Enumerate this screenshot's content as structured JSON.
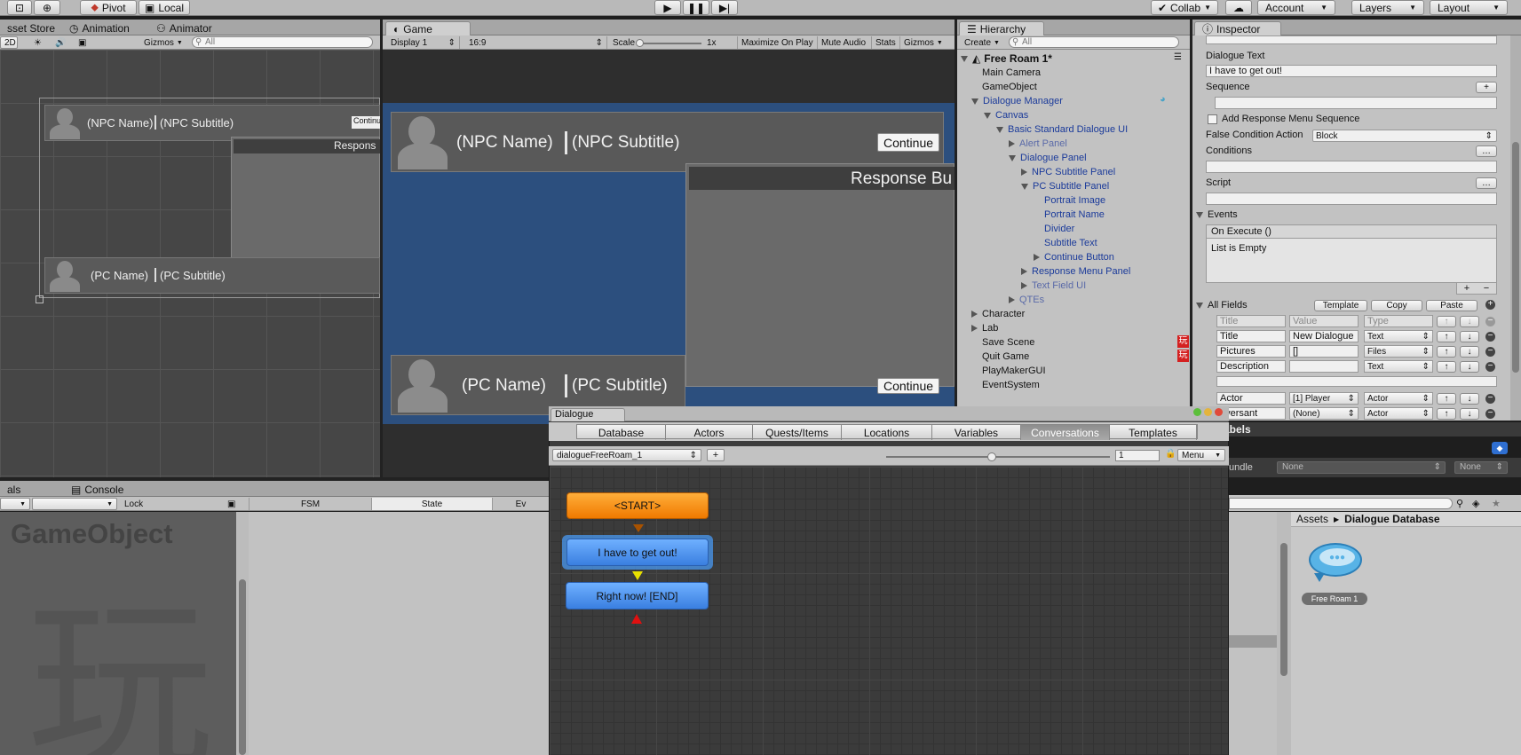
{
  "toolbar": {
    "pivot": "Pivot",
    "local": "Local",
    "collab": "Collab",
    "account": "Account",
    "layers": "Layers",
    "layout": "Layout"
  },
  "scene_panel": {
    "tabs": [
      "sset Store",
      "Animation",
      "Animator"
    ],
    "strip": {
      "mode2d": "2D",
      "gizmos": "Gizmos",
      "search_placeholder": "All"
    },
    "npc_name": "(NPC Name)",
    "npc_subtitle": "(NPC Subtitle)",
    "continue": "Continu",
    "response": "Respons",
    "pc_name": "(PC Name)",
    "pc_subtitle": "(PC Subtitle)"
  },
  "game_panel": {
    "tab": "Game",
    "display": "Display 1",
    "aspect": "16:9",
    "scale_label": "Scale",
    "scale_value": "1x",
    "maximize": "Maximize On Play",
    "mute": "Mute Audio",
    "stats": "Stats",
    "gizmos": "Gizmos",
    "npc_name": "(NPC Name)",
    "npc_subtitle": "(NPC Subtitle)",
    "continue": "Continue",
    "response": "Response Bu",
    "pc_name": "(PC Name)",
    "pc_subtitle": "(PC Subtitle)",
    "pc_continue": "Continue"
  },
  "hierarchy": {
    "tab": "Hierarchy",
    "create": "Create",
    "search_placeholder": "All",
    "scene": "Free Roam 1*",
    "items": [
      {
        "label": "Main Camera",
        "indent": 1,
        "arrow": "",
        "color": "#111111"
      },
      {
        "label": "GameObject",
        "indent": 1,
        "arrow": "",
        "color": "#111111"
      },
      {
        "label": "Dialogue Manager",
        "indent": 1,
        "arrow": "down",
        "color": "#1a3a9a"
      },
      {
        "label": "Canvas",
        "indent": 2,
        "arrow": "down",
        "color": "#1a3a9a"
      },
      {
        "label": "Basic Standard Dialogue UI",
        "indent": 3,
        "arrow": "down",
        "color": "#1a3a9a"
      },
      {
        "label": "Alert Panel",
        "indent": 4,
        "arrow": "right",
        "color": "#5a6aa8"
      },
      {
        "label": "Dialogue Panel",
        "indent": 4,
        "arrow": "down",
        "color": "#1a3a9a"
      },
      {
        "label": "NPC Subtitle Panel",
        "indent": 5,
        "arrow": "right",
        "color": "#1a3a9a"
      },
      {
        "label": "PC Subtitle Panel",
        "indent": 5,
        "arrow": "down",
        "color": "#1a3a9a"
      },
      {
        "label": "Portrait Image",
        "indent": 6,
        "arrow": "",
        "color": "#1a3a9a"
      },
      {
        "label": "Portrait Name",
        "indent": 6,
        "arrow": "",
        "color": "#1a3a9a"
      },
      {
        "label": "Divider",
        "indent": 6,
        "arrow": "",
        "color": "#1a3a9a"
      },
      {
        "label": "Subtitle Text",
        "indent": 6,
        "arrow": "",
        "color": "#1a3a9a"
      },
      {
        "label": "Continue Button",
        "indent": 6,
        "arrow": "right",
        "color": "#1a3a9a"
      },
      {
        "label": "Response Menu Panel",
        "indent": 5,
        "arrow": "right",
        "color": "#1a3a9a"
      },
      {
        "label": "Text Field UI",
        "indent": 5,
        "arrow": "right",
        "color": "#5a6aa8"
      },
      {
        "label": "QTEs",
        "indent": 4,
        "arrow": "right",
        "color": "#5a6aa8"
      },
      {
        "label": "Character",
        "indent": 1,
        "arrow": "right",
        "color": "#111111"
      },
      {
        "label": "Lab",
        "indent": 1,
        "arrow": "right",
        "color": "#111111"
      },
      {
        "label": "Save Scene",
        "indent": 1,
        "arrow": "",
        "color": "#111111"
      },
      {
        "label": "Quit Game",
        "indent": 1,
        "arrow": "",
        "color": "#111111"
      },
      {
        "label": "PlayMakerGUI",
        "indent": 1,
        "arrow": "",
        "color": "#111111"
      },
      {
        "label": "EventSystem",
        "indent": 1,
        "arrow": "",
        "color": "#111111"
      }
    ],
    "badge_glyph": "玩"
  },
  "inspector": {
    "tab": "Inspector",
    "dialogue_text_label": "Dialogue Text",
    "dialogue_text_value": "I have to get out!",
    "sequence_label": "Sequence",
    "add_response_label": "Add Response Menu Sequence",
    "false_condition_label": "False Condition Action",
    "false_condition_value": "Block",
    "conditions_label": "Conditions",
    "script_label": "Script",
    "events_label": "Events",
    "on_execute": "On Execute ()",
    "list_empty": "List is Empty",
    "all_fields_label": "All Fields",
    "template_btn": "Template",
    "copy_btn": "Copy",
    "paste_btn": "Paste",
    "header": {
      "title": "Title",
      "value": "Value",
      "type": "Type"
    },
    "rows": [
      {
        "name": "Title",
        "value": "New Dialogue",
        "type": "Text"
      },
      {
        "name": "Pictures",
        "value": "[]",
        "type": "Files"
      },
      {
        "name": "Description",
        "value": "",
        "type": "Text"
      },
      {
        "name": "Actor",
        "value": "[1] Player",
        "type": "Actor"
      },
      {
        "name": "nversant",
        "value": "(None)",
        "type": "Actor"
      }
    ],
    "labels_caption": "abels",
    "bundle_label": "undle",
    "bundle_value": "None",
    "bundle_variant": "None"
  },
  "dialogue_window": {
    "title": "Dialogue",
    "tabs": [
      "Database",
      "Actors",
      "Quests/Items",
      "Locations",
      "Variables",
      "Conversations",
      "Templates"
    ],
    "active_tab": "Conversations",
    "conversation": "dialogueFreeRoam_1",
    "add": "+",
    "zoom_value": "1",
    "menu": "Menu",
    "nodes": {
      "start": "<START>",
      "line1": "I have to get out!",
      "line2": "Right now! [END]"
    }
  },
  "bottom_left": {
    "tab1": "als",
    "tab2": "Console",
    "lock": "Lock",
    "fsm": "FSM",
    "state": "State",
    "ev": "Ev",
    "gameobject": "GameObject",
    "watermark": "玩"
  },
  "project": {
    "breadcrumb_root": "Assets",
    "breadcrumb_leaf": "Dialogue Database",
    "asset_name": "Free Roam 1"
  }
}
